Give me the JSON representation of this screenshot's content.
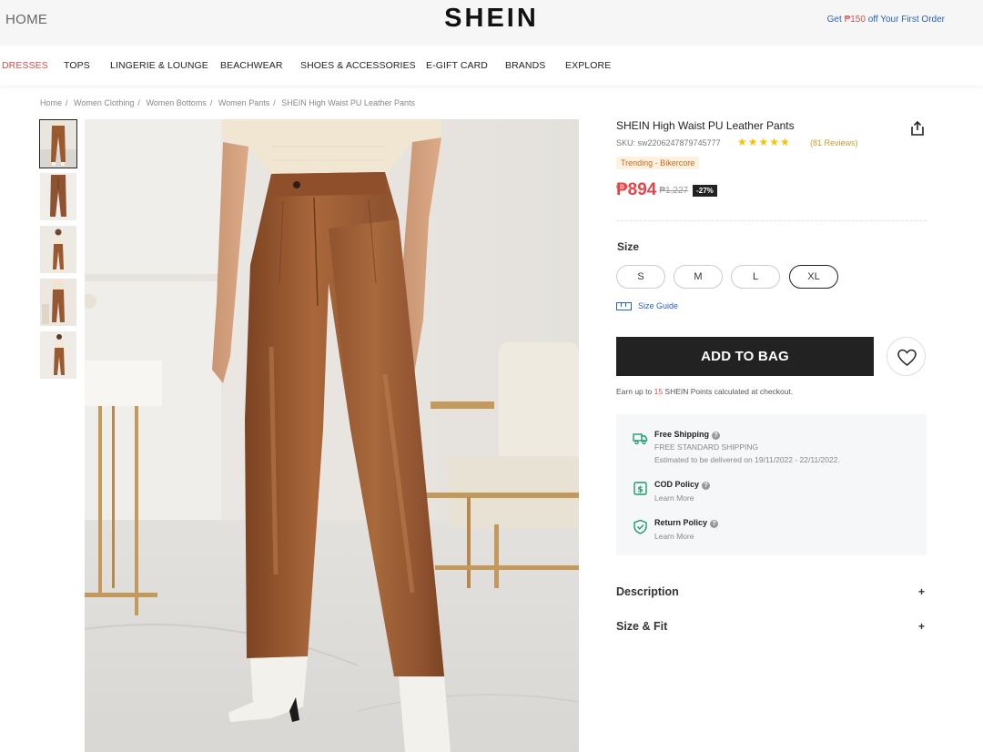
{
  "header": {
    "home": "HOME",
    "logo": "SHEIN",
    "promo_prefix": "Get ",
    "promo_amount": "₱150",
    "promo_suffix": " off Your First Order"
  },
  "nav": {
    "items": [
      "DRESSES",
      "TOPS",
      "LINGERIE & LOUNGE",
      "BEACHWEAR",
      "SHOES & ACCESSORIES",
      "E-GIFT CARD",
      "BRANDS",
      "EXPLORE"
    ],
    "active": "DRESSES"
  },
  "breadcrumb": {
    "items": [
      "Home",
      "Women Clothing",
      "Women Bottoms",
      "Women Pants",
      "SHEIN High Waist PU Leather Pants"
    ],
    "separator": "/"
  },
  "gallery": {
    "thumbnail_count": 5,
    "selected_index": 0
  },
  "product": {
    "title": "SHEIN High Waist PU Leather Pants",
    "sku": "SKU: sw2206247879745777",
    "rating": 4.5,
    "stars": "★★★★★",
    "reviews": "(81 Reviews)",
    "trend_badge": "Trending - Bikercore",
    "price": "₱894",
    "old_price": "₱1,227",
    "discount": "-27%"
  },
  "size": {
    "label": "Size",
    "options": [
      "S",
      "M",
      "L",
      "XL"
    ],
    "selected": "XL",
    "guide": "Size Guide"
  },
  "actions": {
    "add_to_bag": "ADD TO BAG",
    "earn_prefix": "Earn up to ",
    "earn_points": "15",
    "earn_suffix": " SHEIN Points calculated at checkout."
  },
  "shipping": {
    "free_title": "Free Shipping",
    "free_line1": "FREE STANDARD SHIPPING",
    "free_line2": "Estimated to be delivered on 19/11/2022 - 22/11/2022.",
    "cod_title": "COD Policy",
    "cod_sub": "Learn More",
    "return_title": "Return Policy",
    "return_sub": "Learn More",
    "help_glyph": "?"
  },
  "accordions": {
    "description": "Description",
    "size_fit": "Size & Fit",
    "expand_glyph": "+"
  },
  "colors": {
    "accent_red": "#e64545",
    "link_blue": "#2a62b4",
    "button_dark": "#222222",
    "leather_brown": "#9a5a2e"
  },
  "icons": {
    "share": "share-icon",
    "wishlist": "heart-icon",
    "ruler": "ruler-icon",
    "shipping": "truck-icon",
    "cod": "cash-icon",
    "return": "shield-check-icon"
  }
}
